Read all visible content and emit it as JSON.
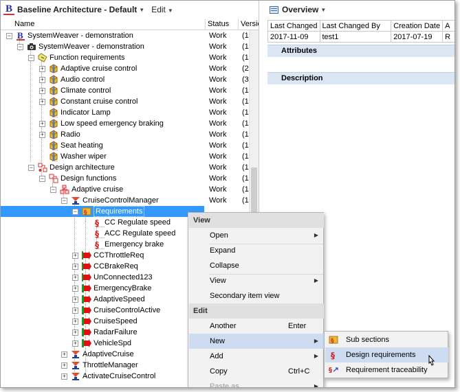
{
  "left_header": {
    "title": "Baseline Architecture - Default",
    "edit_label": "Edit"
  },
  "columns": {
    "name": "Name",
    "status": "Status",
    "version": "Versio"
  },
  "tree": [
    {
      "label": "SystemWeaver - demonstration",
      "status": "Work",
      "ver": "(1",
      "icon": "b-root-icon",
      "expander": "minus"
    },
    {
      "label": "SystemWeaver - demonstration",
      "status": "Work",
      "ver": "(1",
      "icon": "camera-icon",
      "expander": "minus"
    },
    {
      "label": "Function requirements",
      "status": "Work",
      "ver": "(1",
      "icon": "requirement-folder-icon",
      "expander": "minus"
    },
    {
      "label": "Adaptive cruise control",
      "status": "Work",
      "ver": "(2",
      "icon": "package-icon",
      "expander": "plus"
    },
    {
      "label": "Audio control",
      "status": "Work",
      "ver": "(3",
      "icon": "package-icon",
      "expander": "plus"
    },
    {
      "label": "Climate control",
      "status": "Work",
      "ver": "(1",
      "icon": "package-icon",
      "expander": "plus"
    },
    {
      "label": "Constant cruise control",
      "status": "Work",
      "ver": "(1",
      "icon": "package-icon",
      "expander": "plus"
    },
    {
      "label": "Indicator Lamp",
      "status": "Work",
      "ver": "(1",
      "icon": "package-icon",
      "expander": "none"
    },
    {
      "label": "Low speed emergency braking",
      "status": "Work",
      "ver": "(1",
      "icon": "package-icon",
      "expander": "plus"
    },
    {
      "label": "Radio",
      "status": "Work",
      "ver": "(1",
      "icon": "package-icon",
      "expander": "plus"
    },
    {
      "label": "Seat heating",
      "status": "Work",
      "ver": "(1",
      "icon": "package-icon",
      "expander": "none"
    },
    {
      "label": "Washer wiper",
      "status": "Work",
      "ver": "(1",
      "icon": "package-icon",
      "expander": "none"
    },
    {
      "label": "Design architecture",
      "status": "Work",
      "ver": "(1",
      "icon": "design-architecture-icon",
      "expander": "minus"
    },
    {
      "label": "Design functions",
      "status": "Work",
      "ver": "(1",
      "icon": "design-functions-icon",
      "expander": "minus"
    },
    {
      "label": "Adaptive cruise",
      "status": "Work",
      "ver": "(1",
      "icon": "design-function-icon",
      "expander": "minus"
    },
    {
      "label": "CruiseControlManager",
      "status": "Work",
      "ver": "(1",
      "icon": "component-icon",
      "expander": "minus"
    },
    {
      "label": "Requirements",
      "status": "",
      "ver": "",
      "icon": "subsection-icon",
      "expander": "minus"
    },
    {
      "label": "CC Regulate speed",
      "status": "",
      "ver": "",
      "icon": "requirement-icon",
      "expander": "none"
    },
    {
      "label": "ACC Regulate speed",
      "status": "",
      "ver": "",
      "icon": "requirement-icon",
      "expander": "none"
    },
    {
      "label": "Emergency brake",
      "status": "",
      "ver": "",
      "icon": "requirement-icon",
      "expander": "none"
    },
    {
      "label": "CCThrottleReq",
      "status": "",
      "ver": "",
      "icon": "port-out-icon",
      "expander": "plus"
    },
    {
      "label": "CCBrakeReq",
      "status": "",
      "ver": "",
      "icon": "port-out-icon",
      "expander": "plus"
    },
    {
      "label": "UnConnected123",
      "status": "",
      "ver": "",
      "icon": "port-out-icon",
      "expander": "plus"
    },
    {
      "label": "EmergencyBrake",
      "status": "",
      "ver": "",
      "icon": "port-in-icon",
      "expander": "plus"
    },
    {
      "label": "AdaptiveSpeed",
      "status": "",
      "ver": "",
      "icon": "port-in-icon",
      "expander": "plus"
    },
    {
      "label": "CruiseControlActive",
      "status": "",
      "ver": "",
      "icon": "port-in-icon",
      "expander": "plus"
    },
    {
      "label": "CruiseSpeed",
      "status": "",
      "ver": "",
      "icon": "port-in-icon",
      "expander": "plus"
    },
    {
      "label": "RadarFailure",
      "status": "",
      "ver": "",
      "icon": "port-in-icon",
      "expander": "plus"
    },
    {
      "label": "VehicleSpd",
      "status": "",
      "ver": "",
      "icon": "port-in-icon",
      "expander": "plus"
    },
    {
      "label": "AdaptiveCruise",
      "status": "",
      "ver": "",
      "icon": "component-icon",
      "expander": "plus"
    },
    {
      "label": "ThrottleManager",
      "status": "",
      "ver": "",
      "icon": "component-icon",
      "expander": "plus"
    },
    {
      "label": "ActivateCruiseControl",
      "status": "",
      "ver": "",
      "icon": "component-icon",
      "expander": "plus"
    }
  ],
  "overview": {
    "title": "Overview",
    "headers": [
      "Last Changed",
      "Last Changed By",
      "Creation Date",
      "A"
    ],
    "values": [
      "2017-11-09",
      "test1",
      "2017-07-19",
      "R"
    ],
    "attributes_label": "Attributes",
    "description_label": "Description"
  },
  "context_menu": {
    "view_header": "View",
    "open": "Open",
    "expand": "Expand",
    "collapse": "Collapse",
    "view": "View",
    "secondary_view": "Secondary item view",
    "edit_header": "Edit",
    "another": "Another",
    "another_shortcut": "Enter",
    "new": "New",
    "add": "Add",
    "copy": "Copy",
    "copy_shortcut": "Ctrl+C",
    "paste_as": "Paste as"
  },
  "submenu": {
    "sub_sections": "Sub sections",
    "design_requirements": "Design requirements",
    "requirement_traceability": "Requirement traceability"
  },
  "colors": {
    "selection": "#3399ff",
    "menu_highlight": "#cddcf0",
    "section_bar": "#dbe6f4"
  }
}
